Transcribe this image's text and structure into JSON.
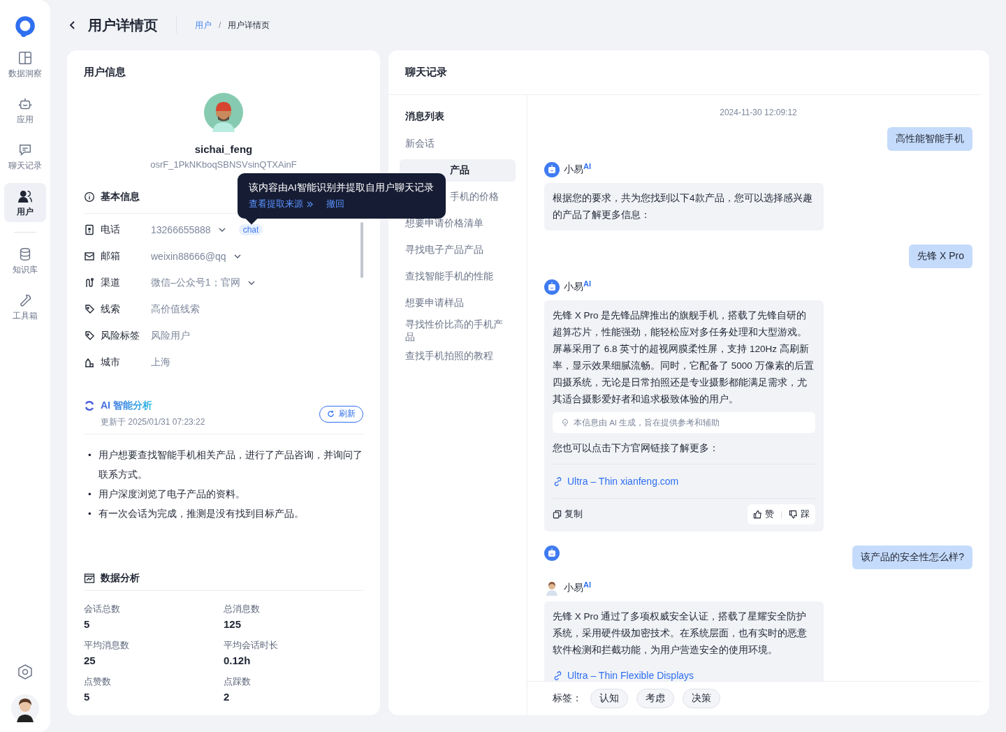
{
  "nav": {
    "items": [
      {
        "label": "数据洞察",
        "selected": false
      },
      {
        "label": "应用",
        "selected": false
      },
      {
        "label": "聊天记录",
        "selected": false
      },
      {
        "label": "用户",
        "selected": true
      },
      {
        "label": "知识库",
        "selected": false
      },
      {
        "label": "工具箱",
        "selected": false
      }
    ]
  },
  "header": {
    "title": "用户详情页",
    "separator": "/",
    "breadcrumb": [
      {
        "label": "用户",
        "link": true
      },
      {
        "label": "用户详情页",
        "link": false
      }
    ]
  },
  "user_info": {
    "title": "用户信息",
    "name": "sichai_feng",
    "id": "osrF_1PkNKboqSBNSVsinQTXAinF",
    "basic_title": "基本信息",
    "fields": [
      {
        "label": "电话",
        "value": "13266655888",
        "dropdown": true,
        "tag": "chat"
      },
      {
        "label": "邮箱",
        "value": "weixin88666@qq",
        "dropdown": true
      },
      {
        "label": "渠道",
        "value": "微信–公众号1；官网",
        "dropdown": true
      },
      {
        "label": "线索",
        "value": "高价值线索",
        "dropdown": false
      },
      {
        "label": "风险标签",
        "value": "风险用户",
        "dropdown": false
      },
      {
        "label": "城市",
        "value": "上海",
        "dropdown": false
      }
    ],
    "tooltip": {
      "text": "该内容由AI智能识别并提取自用户聊天记录",
      "link": "查看提取来源",
      "action": "撤回"
    },
    "ai": {
      "title": "AI 智能分析",
      "updated": "更新于 2025/01/31 07:23:22",
      "refresh": "刷新",
      "marker": "•",
      "bullets": [
        "用户想要查找智能手机相关产品，进行了产品咨询，并询问了联系方式。",
        "用户深度浏览了电子产品的资料。",
        "有一次会话为完成，推测是没有找到目标产品。"
      ]
    },
    "stats_title": "数据分析",
    "stats": [
      {
        "label": "会话总数",
        "value": "5"
      },
      {
        "label": "总消息数",
        "value": "125"
      },
      {
        "label": "平均消息数",
        "value": "25"
      },
      {
        "label": "平均会话时长",
        "value": "0.12h"
      },
      {
        "label": "点赞数",
        "value": "5"
      },
      {
        "label": "点踩数",
        "value": "2"
      }
    ]
  },
  "chat": {
    "title": "聊天记录",
    "list_title": "消息列表",
    "sessions": [
      {
        "label": "新会话",
        "selected": false,
        "covered": false
      },
      {
        "label": "产品",
        "selected": true,
        "covered": true
      },
      {
        "label": "手机的价格",
        "selected": false,
        "covered": true
      },
      {
        "label": "想要申请价格清单",
        "selected": false,
        "covered": false
      },
      {
        "label": "寻找电子产品产品",
        "selected": false,
        "covered": false
      },
      {
        "label": "查找智能手机的性能",
        "selected": false,
        "covered": false
      },
      {
        "label": "想要申请样品",
        "selected": false,
        "covered": false
      },
      {
        "label": "寻找性价比高的手机产品",
        "selected": false,
        "covered": false
      },
      {
        "label": "查找手机拍照的教程",
        "selected": false,
        "covered": false
      }
    ],
    "timestamp": "2024-11-30 12:09:12",
    "messages": [
      {
        "kind": "user",
        "text": "高性能智能手机",
        "bot_avatar": false
      },
      {
        "kind": "bot",
        "name": "小易",
        "badge": "AI",
        "text": "根据您的要求，共为您找到以下4款产品，您可以选择感兴趣的产品了解更多信息："
      },
      {
        "kind": "user",
        "text": "先锋 X Pro",
        "bot_avatar": false
      },
      {
        "kind": "bot",
        "name": "小易",
        "badge": "AI",
        "text": "先锋 X Pro 是先锋品牌推出的旗舰手机，搭载了先锋自研的超算芯片，性能强劲，能轻松应对多任务处理和大型游戏。屏幕采用了 6.8 英寸的超视网膜柔性屏，支持 120Hz 高刷新率，显示效果细腻流畅。同时，它配备了 5000 万像素的后置四摄系统，无论是日常拍照还是专业摄影都能满足需求，尤其适合摄影爱好者和追求极致体验的用户。",
        "notice": "本信息由 AI 生成，旨在提供参考和辅助",
        "more": "您也可以点击下方官网链接了解更多：",
        "link": "Ultra – Thin xianfeng.com",
        "copy": "复制",
        "like": "赞",
        "dislike": "踩"
      },
      {
        "kind": "user",
        "text": "该产品的安全性怎么样?",
        "bot_avatar": true
      },
      {
        "kind": "agent",
        "name": "小易",
        "badge": "AI",
        "text": "先锋 X Pro 通过了多项权威安全认证，搭载了星耀安全防护系统，采用硬件级加密技术。在系统层面，也有实时的恶意软件检测和拦截功能，为用户营造安全的使用环境。",
        "link": "Ultra – Thin Flexible Displays"
      }
    ],
    "tags_label": "标签：",
    "tags": [
      "认知",
      "考虑",
      "决策"
    ]
  }
}
